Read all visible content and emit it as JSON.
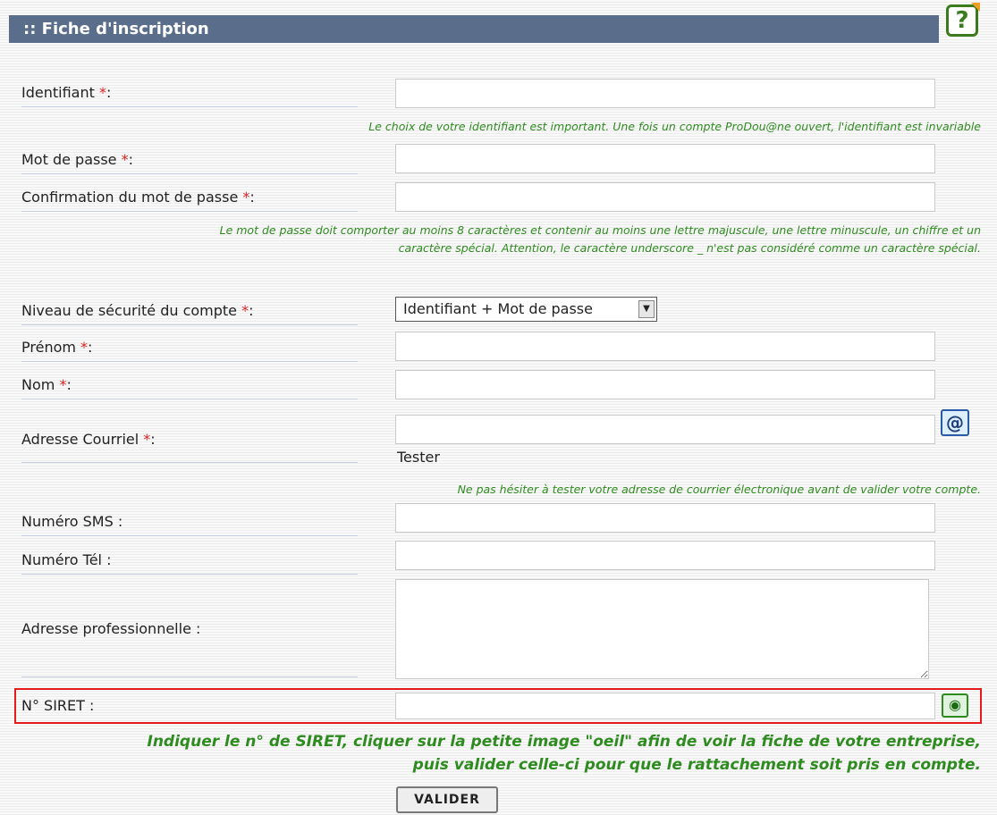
{
  "header": {
    "title": ":: Fiche d'inscription",
    "help_icon": "question-icon"
  },
  "fields": {
    "identifiant": {
      "label": "Identifiant ",
      "req": "*",
      "suffix": ":",
      "value": ""
    },
    "mot_de_passe": {
      "label": "Mot de passe ",
      "req": "*",
      "suffix": ":",
      "value": ""
    },
    "confirmation": {
      "label": "Confirmation du mot de passe ",
      "req": "*",
      "suffix": ":",
      "value": ""
    },
    "securite": {
      "label": "Niveau de sécurité du compte ",
      "req": "*",
      "suffix": ":",
      "selected": "Identifiant + Mot de passe"
    },
    "prenom": {
      "label": "Prénom ",
      "req": "*",
      "suffix": ":",
      "value": ""
    },
    "nom": {
      "label": "Nom ",
      "req": "*",
      "suffix": ":",
      "value": ""
    },
    "courriel": {
      "label": "Adresse Courriel ",
      "req": "*",
      "suffix": ":",
      "value": "",
      "test_label": "Tester",
      "icon": "email-at-icon"
    },
    "sms": {
      "label": "Numéro SMS :",
      "value": ""
    },
    "tel": {
      "label": "Numéro Tél :",
      "value": ""
    },
    "adresse": {
      "label": "Adresse professionnelle :",
      "value": ""
    },
    "siret": {
      "label": "N° SIRET :",
      "value": "",
      "icon": "eye-icon"
    }
  },
  "hints": {
    "identifiant": "Le choix de votre identifiant est important. Une fois un compte ProDou@ne ouvert, l'identifiant est invariable",
    "password_line1": "Le mot de passe doit comporter au moins 8 caractères et contenir au moins une lettre majuscule, une lettre minuscule, un chiffre et un",
    "password_line2": "caractère spécial. Attention, le caractère underscore _ n'est pas considéré comme un caractère spécial.",
    "courriel": "Ne pas hésiter à tester votre adresse de courrier électronique avant de valider votre compte.",
    "siret_line1": "Indiquer le n° de SIRET, cliquer sur la petite image \"oeil\" afin de voir la fiche de votre entreprise,",
    "siret_line2": "puis valider celle-ci pour que le rattachement soit pris en compte."
  },
  "submit": {
    "label": "VALIDER"
  },
  "colors": {
    "header_bg": "#5a6e8c",
    "hint_green": "#2e8b1f",
    "required_red": "#e02020",
    "siret_border": "#e41b1b"
  }
}
